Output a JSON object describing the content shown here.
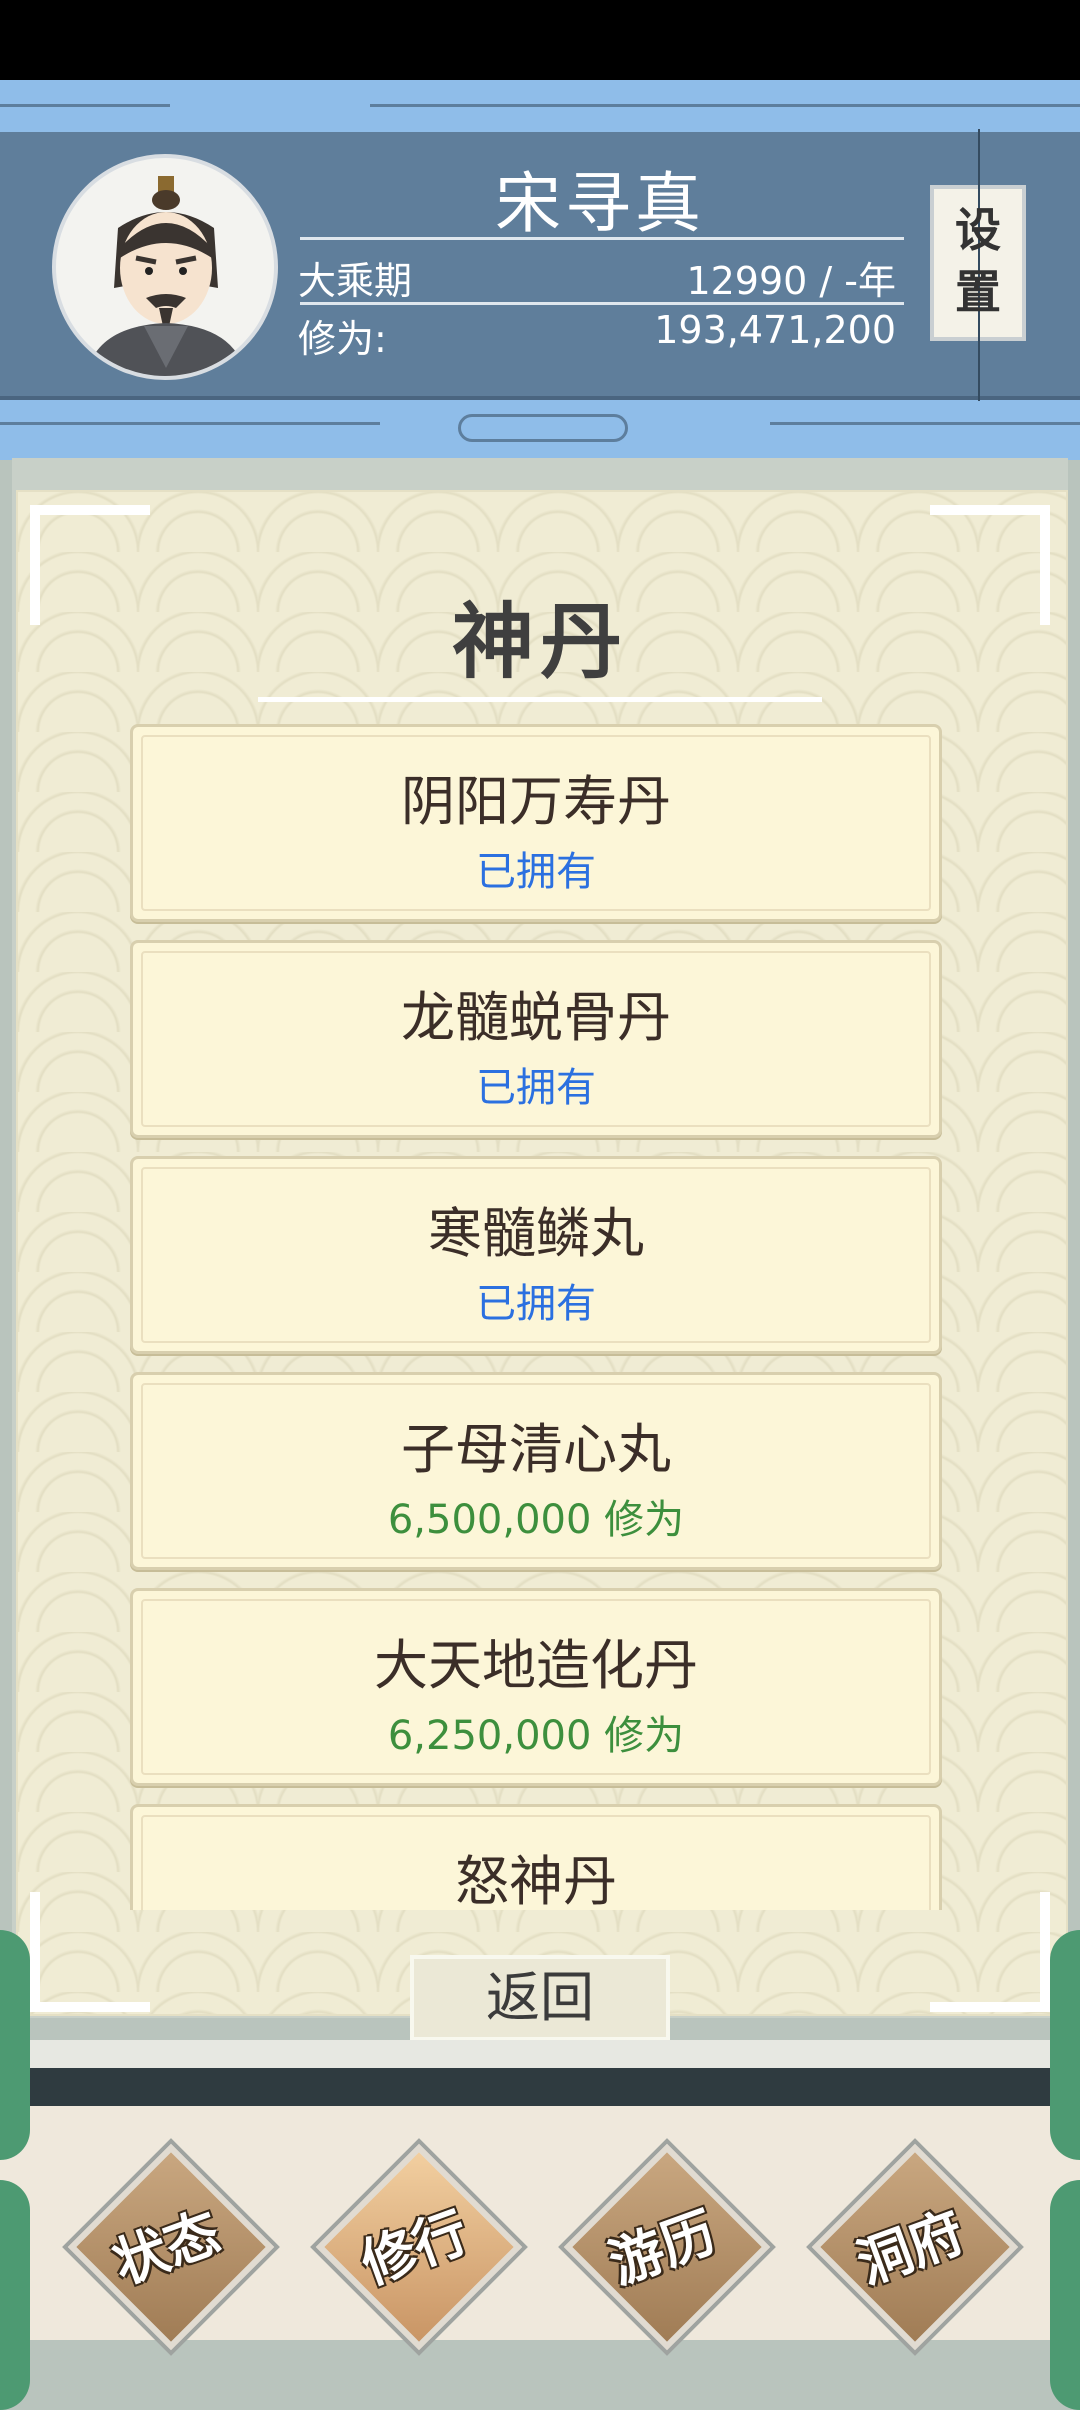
{
  "header": {
    "name": "宋寻真",
    "realm": "大乘期",
    "age": "12990 / -年",
    "cultivation_label": "修为:",
    "cultivation_value": "193,471,200",
    "settings_label": "设置",
    "settings_char1": "设",
    "settings_char2": "置"
  },
  "panel": {
    "title": "神丹",
    "items": [
      {
        "name": "阴阳万寿丹",
        "status": "已拥有"
      },
      {
        "name": "龙髓蜕骨丹",
        "status": "已拥有"
      },
      {
        "name": "寒髓鳞丸",
        "status": "已拥有"
      },
      {
        "name": "子母清心丸",
        "status": "6,500,000 修为"
      },
      {
        "name": "大天地造化丹",
        "status": "6,250,000 修为"
      },
      {
        "name": "怒神丹",
        "status": ""
      }
    ],
    "back_label": "返回"
  },
  "bottom_nav": {
    "items": [
      {
        "label": "状态"
      },
      {
        "label": "修行"
      },
      {
        "label": "游历"
      },
      {
        "label": "洞府"
      }
    ]
  },
  "colors": {
    "owned": "#2b70e0",
    "cost": "#3d8f3d",
    "header_bg": "#5f7e9b"
  }
}
